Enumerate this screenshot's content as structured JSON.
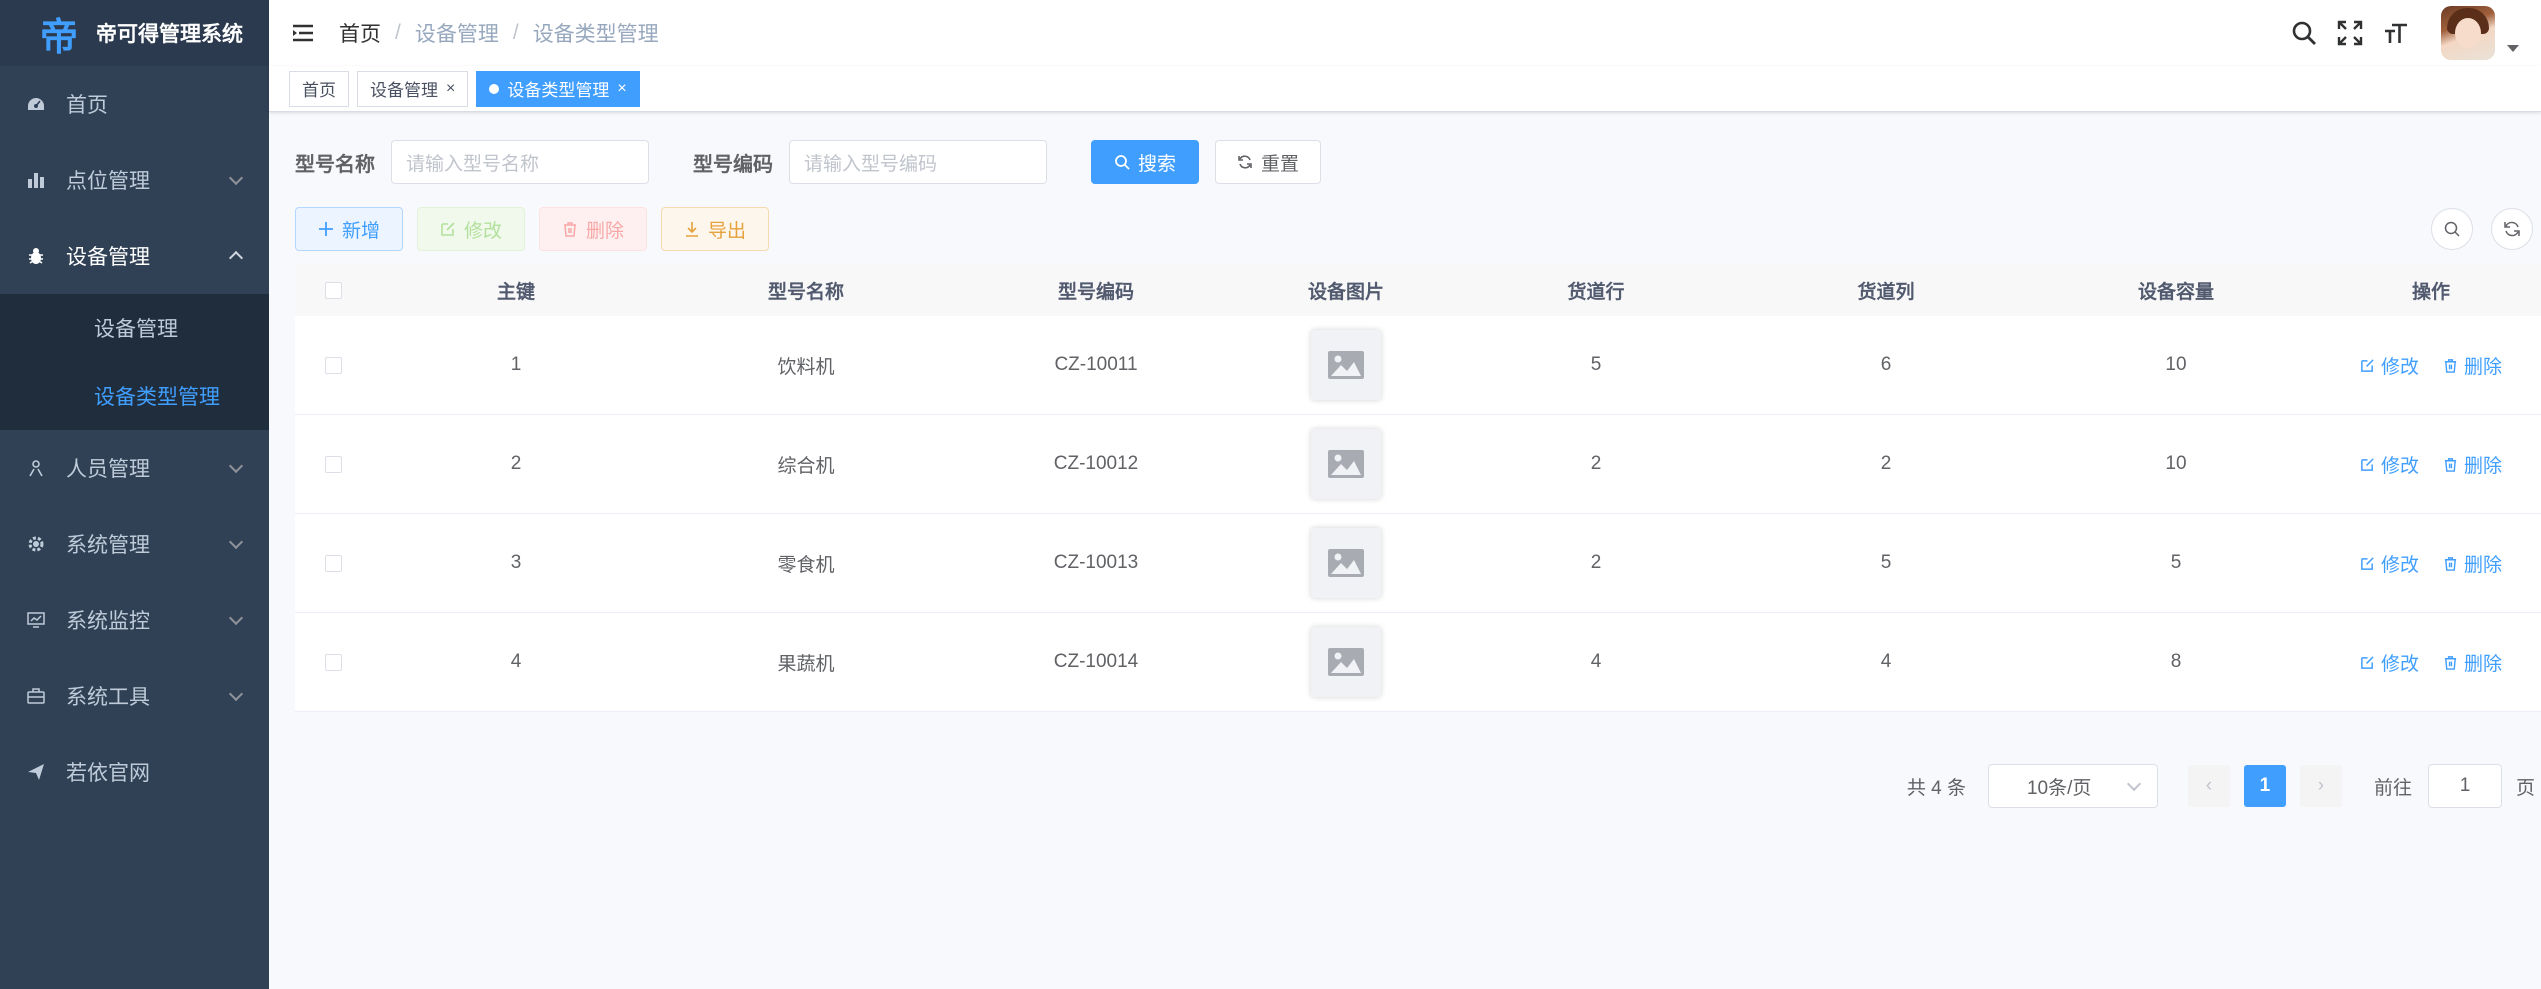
{
  "app": {
    "title": "帝可得管理系统",
    "logo_char": "帝"
  },
  "sidebar": {
    "items": [
      {
        "label": "首页",
        "icon": "dashboard-icon"
      },
      {
        "label": "点位管理",
        "icon": "chart-icon"
      },
      {
        "label": "设备管理",
        "icon": "bug-icon",
        "open": true,
        "children": [
          {
            "label": "设备管理"
          },
          {
            "label": "设备类型管理",
            "active": true
          }
        ]
      },
      {
        "label": "人员管理",
        "icon": "peoples-icon"
      },
      {
        "label": "系统管理",
        "icon": "system-icon"
      },
      {
        "label": "系统监控",
        "icon": "monitor-icon"
      },
      {
        "label": "系统工具",
        "icon": "tool-icon"
      },
      {
        "label": "若依官网",
        "icon": "guide-icon"
      }
    ]
  },
  "breadcrumb": [
    "首页",
    "设备管理",
    "设备类型管理"
  ],
  "tags": [
    "首页",
    "设备管理",
    "设备类型管理"
  ],
  "search": {
    "name_label": "型号名称",
    "name_placeholder": "请输入型号名称",
    "code_label": "型号编码",
    "code_placeholder": "请输入型号编码",
    "search_btn": "搜索",
    "reset_btn": "重置"
  },
  "toolbar": {
    "add": "新增",
    "edit": "修改",
    "delete": "删除",
    "export": "导出"
  },
  "table": {
    "headers": [
      "主键",
      "型号名称",
      "型号编码",
      "设备图片",
      "货道行",
      "货道列",
      "设备容量",
      "操作"
    ],
    "rows": [
      {
        "id": "1",
        "name": "饮料机",
        "code": "CZ-10011",
        "row": "5",
        "col": "6",
        "cap": "10"
      },
      {
        "id": "2",
        "name": "综合机",
        "code": "CZ-10012",
        "row": "2",
        "col": "2",
        "cap": "10"
      },
      {
        "id": "3",
        "name": "零食机",
        "code": "CZ-10013",
        "row": "2",
        "col": "5",
        "cap": "5"
      },
      {
        "id": "4",
        "name": "果蔬机",
        "code": "CZ-10014",
        "row": "4",
        "col": "4",
        "cap": "8"
      }
    ],
    "op_edit": "修改",
    "op_delete": "删除"
  },
  "pagination": {
    "total": "共 4 条",
    "page_size": "10条/页",
    "current": "1",
    "goto_label": "前往",
    "goto_value": "1",
    "page_unit": "页"
  },
  "colors": {
    "primary": "#409eff",
    "sidebar_bg": "#304156",
    "submenu_bg": "#1f2d3d"
  }
}
